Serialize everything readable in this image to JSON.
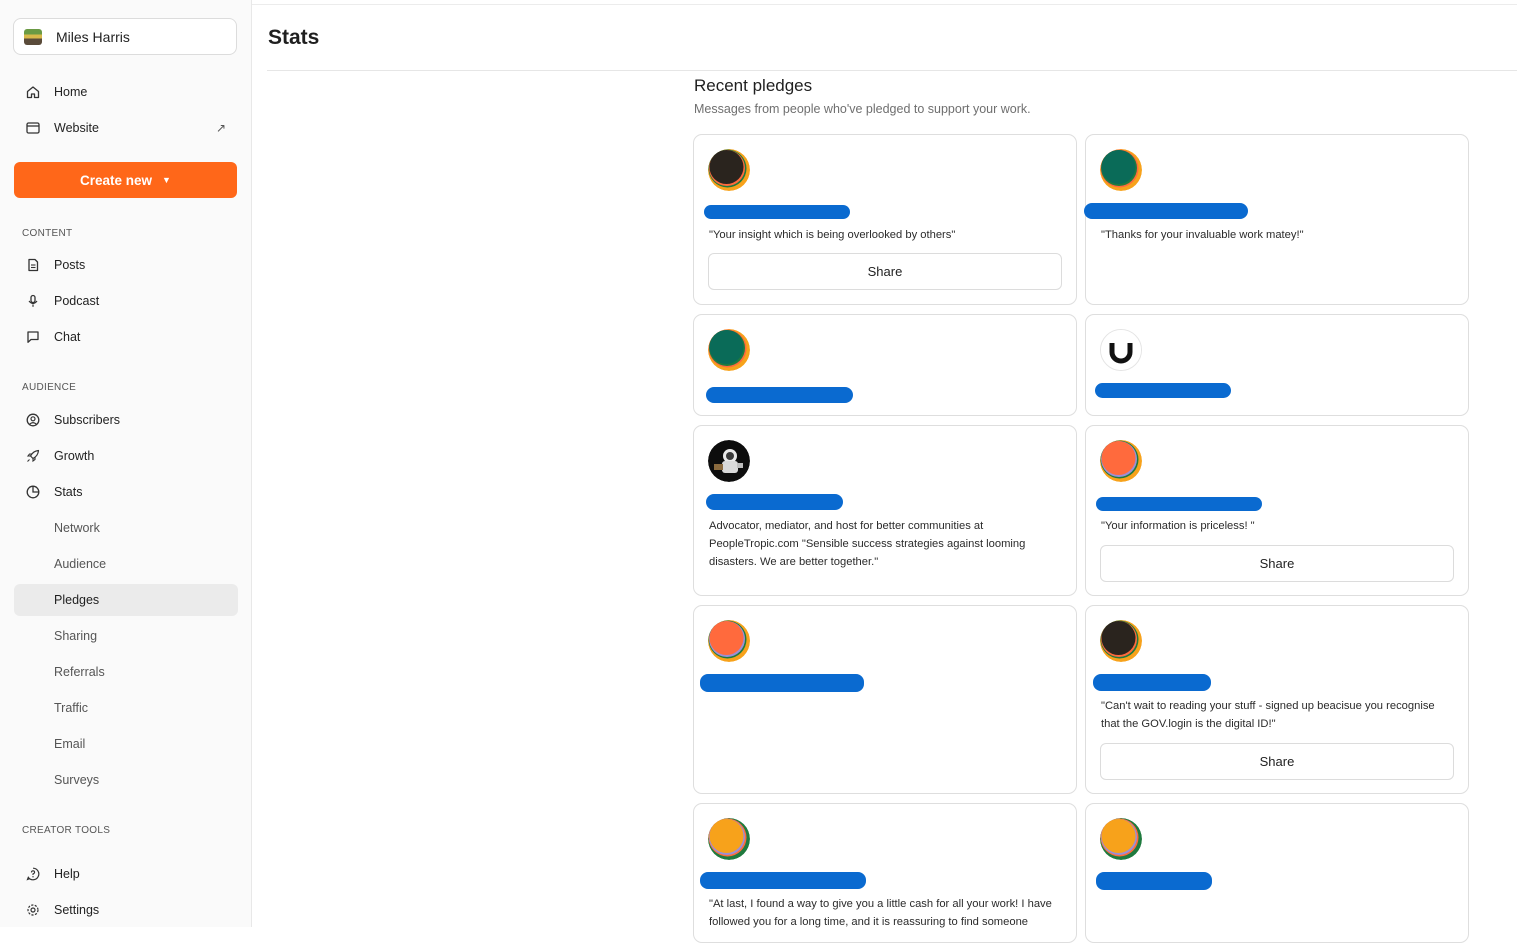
{
  "sidebar": {
    "publication": "Miles Harris",
    "home": "Home",
    "website": "Website",
    "create_new": "Create new",
    "content_heading": "CONTENT",
    "posts": "Posts",
    "podcast": "Podcast",
    "chat": "Chat",
    "audience_heading": "AUDIENCE",
    "subscribers": "Subscribers",
    "growth": "Growth",
    "stats": "Stats",
    "stats_sub": [
      "Network",
      "Audience",
      "Pledges",
      "Sharing",
      "Referrals",
      "Traffic",
      "Email",
      "Surveys"
    ],
    "creator_tools_heading": "CREATOR TOOLS",
    "help": "Help",
    "settings": "Settings",
    "active_item": "Pledges"
  },
  "page": {
    "title": "Stats",
    "section_title": "Recent pledges",
    "section_subtitle": "Messages from people who've pledged to support your work."
  },
  "pledges": [
    {
      "avatar": "dark",
      "message": "\"Your insight which is being overlooked by others\"",
      "share": "Share"
    },
    {
      "avatar": "green",
      "message": "\"Thanks for your invaluable work matey!\"",
      "share": ""
    },
    {
      "avatar": "green",
      "message": "",
      "share": ""
    },
    {
      "avatar": "magnet",
      "message": "",
      "share": ""
    },
    {
      "avatar": "astronaut",
      "message": "Advocator, mediator, and host for better communities at PeopleTropic.com \"Sensible success strategies against looming disasters. We are better together.\"",
      "share": ""
    },
    {
      "avatar": "orange",
      "message": "\"Your information is priceless! \"",
      "share": "Share"
    },
    {
      "avatar": "orange",
      "message": "",
      "share": ""
    },
    {
      "avatar": "dark",
      "message": "\"Can't wait to reading your stuff - signed up beacisue you recognise that the GOV.login is the digital ID!\"",
      "share": "Share"
    },
    {
      "avatar": "yellow",
      "message": "\"At last, I found a way to give you a little cash for all your work! I have followed you for a long time, and it is reassuring to find someone",
      "share": ""
    },
    {
      "avatar": "yellow",
      "message": "",
      "share": ""
    }
  ],
  "colors": {
    "accent": "#ff6719",
    "redaction": "#0a6ad0"
  }
}
